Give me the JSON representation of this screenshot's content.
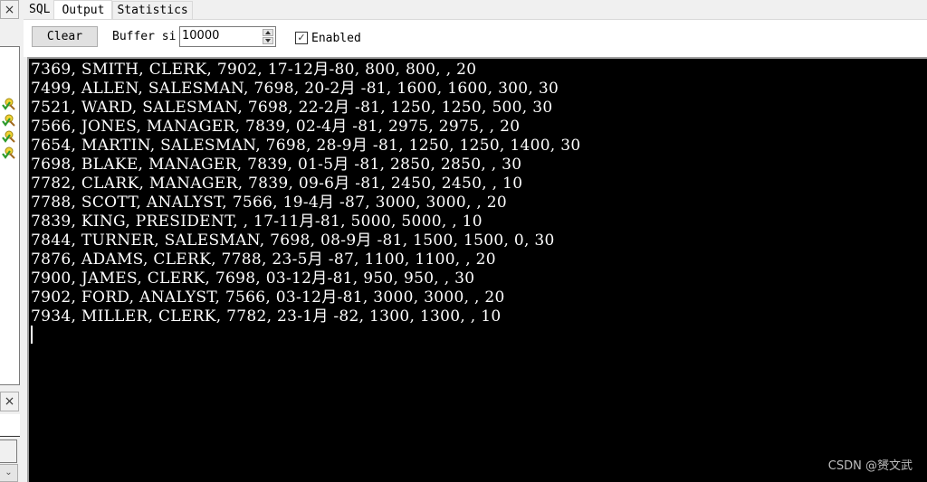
{
  "left_panel": {
    "close_icon": "×",
    "close2_icon": "×",
    "chevron_icon": "⌄",
    "items": [
      {
        "icon": "key-check-icon"
      },
      {
        "icon": "key-check-icon"
      },
      {
        "icon": "key-check-icon"
      },
      {
        "icon": "key-check-icon"
      }
    ]
  },
  "tabs": [
    {
      "label": "SQL",
      "active": false
    },
    {
      "label": "Output",
      "active": true
    },
    {
      "label": "Statistics",
      "active": false
    }
  ],
  "toolbar": {
    "clear_label": "Clear",
    "buffer_label": "Buffer si",
    "buffer_value": "10000",
    "enabled_checked": true,
    "enabled_check_glyph": "✓",
    "enabled_label": "Enabled"
  },
  "output": {
    "lines": [
      "7369, SMITH, CLERK, 7902, 17-12月-80, 800, 800, , 20",
      "7499, ALLEN, SALESMAN, 7698, 20-2月 -81, 1600, 1600, 300, 30",
      "7521, WARD, SALESMAN, 7698, 22-2月 -81, 1250, 1250, 500, 30",
      "7566, JONES, MANAGER, 7839, 02-4月 -81, 2975, 2975, , 20",
      "7654, MARTIN, SALESMAN, 7698, 28-9月 -81, 1250, 1250, 1400, 30",
      "7698, BLAKE, MANAGER, 7839, 01-5月 -81, 2850, 2850, , 30",
      "7782, CLARK, MANAGER, 7839, 09-6月 -81, 2450, 2450, , 10",
      "7788, SCOTT, ANALYST, 7566, 19-4月 -87, 3000, 3000, , 20",
      "7839, KING, PRESIDENT, , 17-11月-81, 5000, 5000, , 10",
      "7844, TURNER, SALESMAN, 7698, 08-9月 -81, 1500, 1500, 0, 30",
      "7876, ADAMS, CLERK, 7788, 23-5月 -87, 1100, 1100, , 20",
      "7900, JAMES, CLERK, 7698, 03-12月-81, 950, 950, , 30",
      "7902, FORD, ANALYST, 7566, 03-12月-81, 3000, 3000, , 20",
      "7934, MILLER, CLERK, 7782, 23-1月 -82, 1300, 1300, , 10"
    ]
  },
  "watermark": "CSDN @赟文武"
}
